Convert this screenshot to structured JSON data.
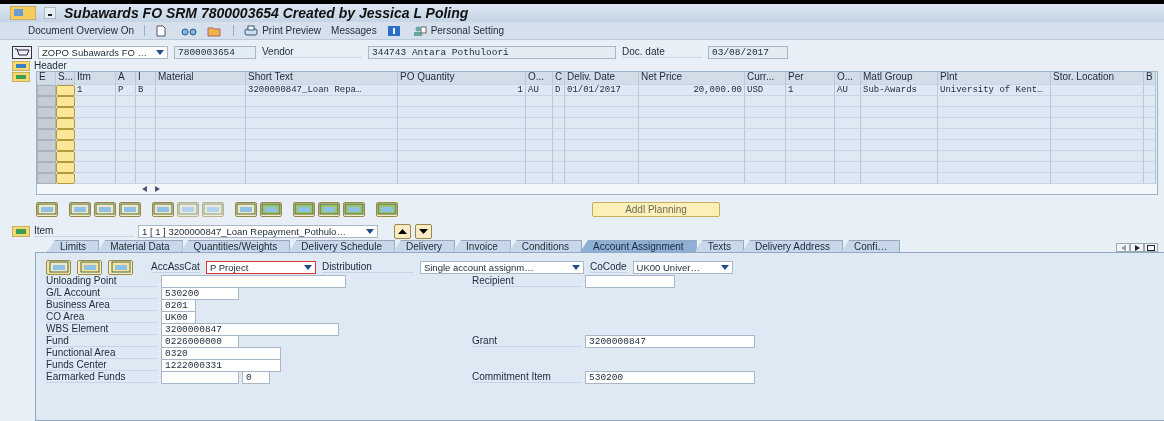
{
  "window": {
    "title": "Subawards FO SRM 7800003654 Created by Jessica L Poling"
  },
  "toolbar": {
    "items": [
      {
        "kind": "text",
        "label": "Document Overview On"
      },
      {
        "kind": "sep"
      },
      {
        "kind": "icon"
      },
      {
        "kind": "icon"
      },
      {
        "kind": "icon"
      },
      {
        "kind": "sep"
      },
      {
        "kind": "iconText",
        "label": "Print Preview"
      },
      {
        "kind": "text",
        "label": "Messages"
      },
      {
        "kind": "icon"
      },
      {
        "kind": "iconText",
        "label": "Personal Setting"
      }
    ]
  },
  "header_fields": {
    "doc_type": "ZOPO Subawards FO …",
    "doc_number": "7800003654",
    "vendor_label": "Vendor",
    "vendor": "344743 Antara Pothuloori",
    "date_label": "Doc. date",
    "date": "03/08/2017"
  },
  "header_section": {
    "label": "Header"
  },
  "table": {
    "columns": [
      "E",
      "S...",
      "Itm",
      "A",
      "I",
      "Material",
      "Short Text",
      "PO Quantity",
      "O...",
      "C",
      "Deliv. Date",
      "Net Price",
      "Curr...",
      "Per",
      "O...",
      "Matl Group",
      "Plnt",
      "Stor. Location",
      "B"
    ],
    "rows": [
      {
        "kind": "item",
        "cells": [
          "",
          "",
          "1",
          "P",
          "B",
          "",
          "3200000847_Loan Repa…",
          "1",
          "AU",
          "D",
          "01/01/2017",
          "20,000.00",
          "USD",
          "1",
          "AU",
          "Sub-Awards",
          "University of Kent…",
          "",
          ""
        ]
      },
      {
        "kind": "blank"
      },
      {
        "kind": "blank"
      },
      {
        "kind": "blank"
      },
      {
        "kind": "blank"
      },
      {
        "kind": "blank"
      },
      {
        "kind": "blank"
      },
      {
        "kind": "blank"
      },
      {
        "kind": "blank"
      }
    ]
  },
  "addl_planning": {
    "label": "Addl Planning"
  },
  "item_bar": {
    "label": "Item",
    "selector": "1 [ 1 ] 3200000847_Loan Repayment_Pothulo…"
  },
  "tabs": [
    {
      "label": "Limits",
      "selected": false
    },
    {
      "label": "Material Data",
      "selected": false
    },
    {
      "label": "Quantities/Weights",
      "selected": false
    },
    {
      "label": "Delivery Schedule",
      "selected": false
    },
    {
      "label": "Delivery",
      "selected": false
    },
    {
      "label": "Invoice",
      "selected": false
    },
    {
      "label": "Conditions",
      "selected": false
    },
    {
      "label": "Account Assignment",
      "selected": true
    },
    {
      "label": "Texts",
      "selected": false
    },
    {
      "label": "Delivery Address",
      "selected": false
    },
    {
      "label": "Confi…",
      "selected": false
    }
  ],
  "account": {
    "acc_label": "AccAssCat",
    "acc_value": "P Project",
    "dist_label": "Distribution",
    "dist_value": "Single account assignm…",
    "cocode_label": "CoCode",
    "cocode_value": "UK00 Univer…",
    "rows": [
      {
        "label": "Unloading Point",
        "fields": [
          {
            "kind": "blank"
          }
        ],
        "right": {
          "label": "Recipient"
        }
      },
      {
        "label": "G/L Account",
        "fields": [
          {
            "value": "530200"
          }
        ]
      },
      {
        "label": "Business Area",
        "fields": [
          {
            "value": "0201"
          }
        ]
      },
      {
        "label": "CO Area",
        "fields": [
          {
            "value": "UK00"
          }
        ]
      },
      {
        "label": "WBS Element",
        "fields": [
          {
            "value": "3200000847"
          }
        ]
      },
      {
        "label": "Fund",
        "fields": [
          {
            "value": "0226000000"
          }
        ],
        "right": {
          "label": "Grant",
          "value": "3200000847"
        }
      },
      {
        "label": "Functional Area",
        "fields": [
          {
            "value": "0320"
          }
        ]
      },
      {
        "label": "Funds Center",
        "fields": [
          {
            "value": "1222000331"
          }
        ]
      },
      {
        "label": "Earmarked Funds",
        "fields": [
          {
            "kind": "blank"
          },
          {
            "value": "0"
          }
        ],
        "right": {
          "label": "Commitment Item",
          "value": "530200"
        }
      }
    ]
  }
}
